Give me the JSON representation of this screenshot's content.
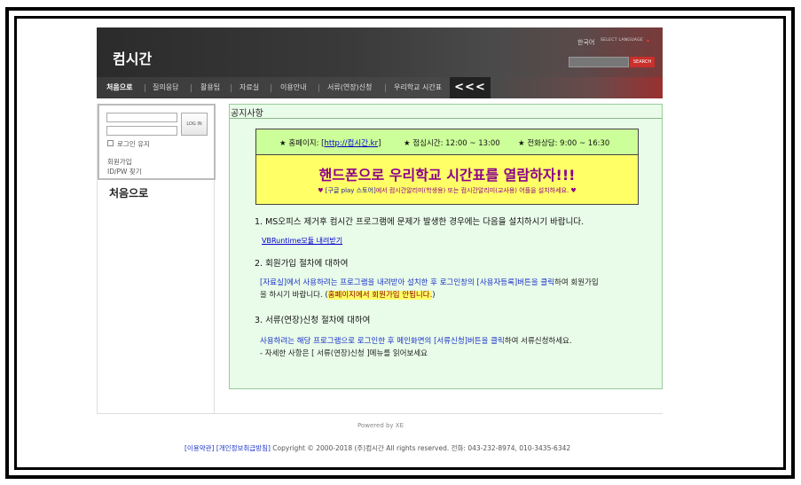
{
  "header": {
    "logo": "컴시간",
    "language": "한국어",
    "language_select": "SELECT LANGUAGE",
    "search_button": "SEARCH"
  },
  "nav": {
    "items": [
      {
        "label": "처음으로"
      },
      {
        "label": "질의응답"
      },
      {
        "label": "활용팁"
      },
      {
        "label": "자료실"
      },
      {
        "label": "이용안내"
      },
      {
        "label": "서류(연장)신청"
      },
      {
        "label": "우리학교 시간표"
      }
    ],
    "collapse": "<<<"
  },
  "sidebar": {
    "login_button": "LOG IN",
    "keep_login": "로그인 유지",
    "signup": "회원가입",
    "find_password": "ID/PW 찾기",
    "title": "처음으로"
  },
  "main": {
    "title": "공지사항",
    "info": {
      "homepage_label": "★ 홈페이지: [",
      "homepage_link": "http://컴시간.kr",
      "homepage_close": "]",
      "lunch": "★ 점심시간: 12:00 ~ 13:00",
      "phone": "★ 전화상담: 9:00 ~ 16:30"
    },
    "banner": "핸드폰으로 우리학교 시간표를 열람하자!!!",
    "banner_sub_pre": "♥ ",
    "banner_sub_blue": "[구글 play 스토어]",
    "banner_sub_post": "에서 컴시간알리미(학생용) 또는 컴시간알리미(교사용) 어플을 설치하세요. ♥",
    "sections": [
      {
        "title": "1. MS오피스 제거후 컴시간 프로그램에 문제가 발생한 경우에는 다음을 설치하시기 바랍니다."
      },
      {
        "title": "2. 회원가입 절차에 대하여"
      },
      {
        "title": "3. 서류(연장)신청 절차에 대하여"
      }
    ],
    "vb_link": "VBRuntime모듈 내려받기",
    "signup_para_blue": "[자료실]에서 사용하려는 프로그램을 내려받아 설치한 후 로그인창의 [사용자등록]버튼을 클릭",
    "signup_para_rest": "하여 회원가입",
    "signup_para_line2": "을 하시기 바랍니다. (",
    "signup_para_hl": "홈페이지에서 회원가입 안됩니다.",
    "signup_para_end": ")",
    "doc_para_blue": "사용하려는 해당 프로그램으로 로그인한 후 메인화면의 [서류신청]버튼을 클릭",
    "doc_para_rest": "하여 서류신청하세요.",
    "doc_para_line2": "- 자세한 사항은 [ 서류(연장)신청 ]메뉴를 읽어보세요"
  },
  "footer": {
    "powered": "Powered by XE",
    "terms": "[이용약관]",
    "privacy": "[개인정보취급방침]",
    "copyright": "Copyright © 2000-2018 (주)컴시간 All rights reserved. 전화: 043-232-8974, 010-3435-6342"
  }
}
